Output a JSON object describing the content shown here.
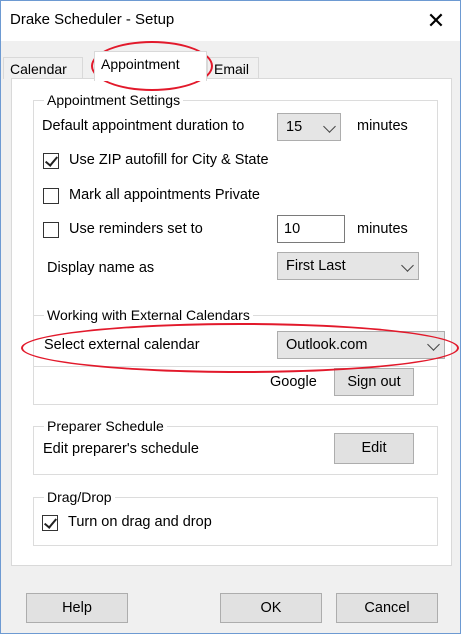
{
  "window": {
    "title": "Drake Scheduler - Setup",
    "close_symbol": "✕"
  },
  "tabs": [
    {
      "label": "Calendar"
    },
    {
      "label": "Appointment"
    },
    {
      "label": "Email"
    }
  ],
  "appointment_settings": {
    "group_label": "Appointment Settings",
    "duration_label": "Default appointment duration to",
    "duration_value": "15",
    "duration_unit": "minutes",
    "zip_autofill_label": "Use ZIP autofill for City & State",
    "zip_autofill_checked": true,
    "private_label": "Mark all appointments Private",
    "private_checked": false,
    "reminders_label": "Use reminders set to",
    "reminders_checked": false,
    "reminders_value": "10",
    "reminders_unit": "minutes",
    "display_name_label": "Display name as",
    "display_name_value": "First Last"
  },
  "external_calendars": {
    "group_label": "Working with External Calendars",
    "select_label": "Select external calendar",
    "select_value": "Outlook.com",
    "account_label": "Google",
    "sign_out_label": "Sign out"
  },
  "preparer_schedule": {
    "group_label": "Preparer Schedule",
    "edit_label": "Edit preparer's schedule",
    "edit_button": "Edit"
  },
  "drag_drop": {
    "group_label": "Drag/Drop",
    "toggle_label": "Turn on drag and drop",
    "toggle_checked": true
  },
  "footer": {
    "help": "Help",
    "ok": "OK",
    "cancel": "Cancel"
  },
  "highlight_color": "#e2192b"
}
